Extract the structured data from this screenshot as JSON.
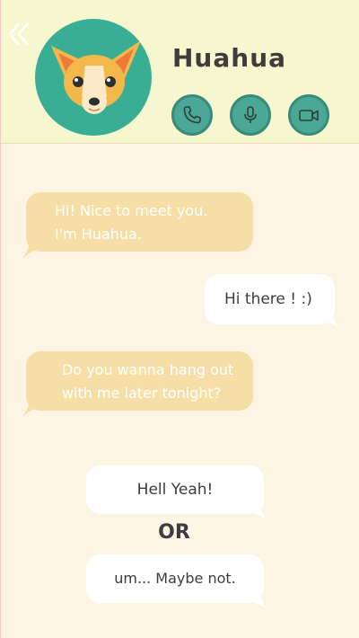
{
  "contact": {
    "name": "Huahua"
  },
  "header": {
    "actions": [
      {
        "name": "phone",
        "icon": "phone-icon"
      },
      {
        "name": "voice",
        "icon": "microphone-icon"
      },
      {
        "name": "video",
        "icon": "video-camera-icon"
      }
    ],
    "back_icon": "double-chevron-left-icon",
    "colors": {
      "background": "#f7f7cf",
      "avatar": "#3aae95",
      "action": "#4aa896"
    }
  },
  "messages": [
    {
      "from": "contact",
      "lines": [
        "Hi! Nice to meet you.",
        "I'm Huahua."
      ]
    },
    {
      "from": "me",
      "lines": [
        "Hi there ! :)"
      ]
    },
    {
      "from": "contact",
      "lines": [
        "Do you wanna hang out",
        "with me later tonight?"
      ]
    }
  ],
  "replies": {
    "option_a": "Hell Yeah!",
    "separator": "OR",
    "option_b": "um... Maybe not."
  },
  "colors": {
    "page_background": "#fcf5e4",
    "incoming_bubble": "#f6dfa7",
    "outgoing_bubble": "#ffffff",
    "text_dark": "#3d3d3d"
  }
}
